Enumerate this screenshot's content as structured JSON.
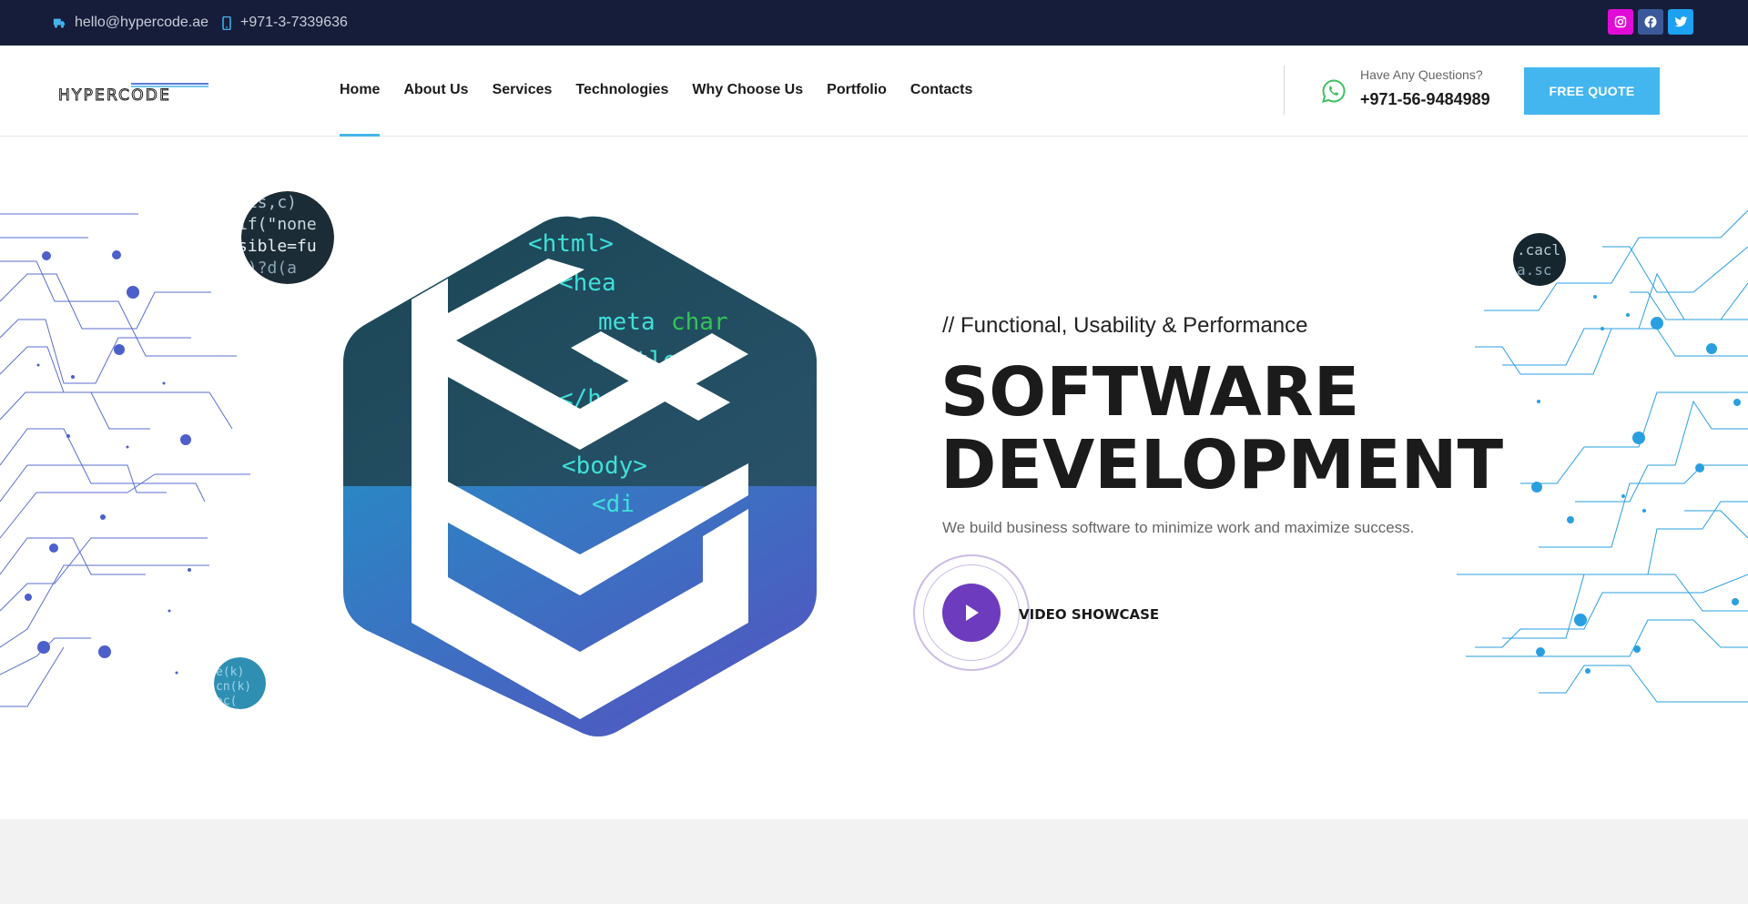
{
  "topbar": {
    "email": "hello@hypercode.ae",
    "phone": "+971-3-7339636",
    "social": [
      "instagram-icon",
      "facebook-icon",
      "twitter-icon"
    ],
    "background": "#161d3a"
  },
  "header": {
    "logo_text": "HYPERCODE",
    "nav": [
      {
        "label": "Home",
        "active": true
      },
      {
        "label": "About Us"
      },
      {
        "label": "Services"
      },
      {
        "label": "Technologies"
      },
      {
        "label": "Why Choose Us"
      },
      {
        "label": "Portfolio"
      },
      {
        "label": "Contacts"
      }
    ],
    "questions_label": "Have Any Questions?",
    "questions_phone": "+971-56-9484989",
    "cta_label": "FREE QUOTE",
    "accent": "#43b6f0"
  },
  "hero": {
    "tagline": "// Functional, Usability & Performance",
    "title_line1": "SOFTWARE",
    "title_line2": "DEVELOPMENT",
    "subtitle": "We build business software to minimize work and maximize success.",
    "video_label": "VIDEO SHOWCASE",
    "play_color": "#6d3bbd",
    "code_snippets": [
      "<html>",
      "<hea",
      "meta",
      "char",
      "<title>",
      "</he",
      "<body>",
      "<di"
    ]
  }
}
